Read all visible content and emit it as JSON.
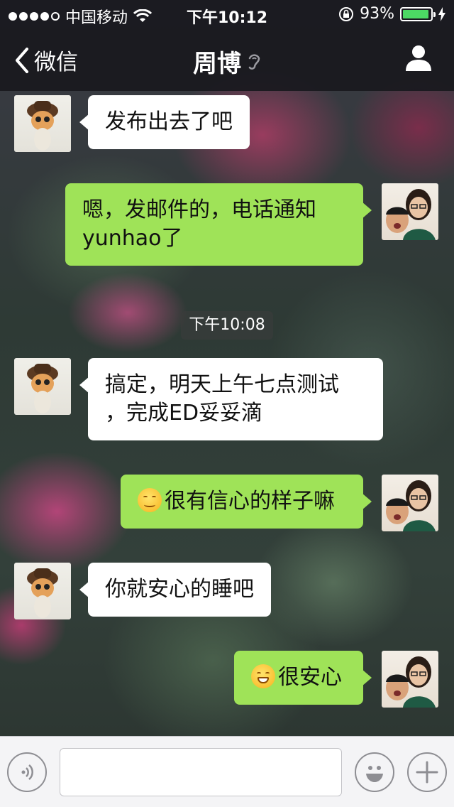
{
  "status_bar": {
    "carrier": "中国移动",
    "time": "下午10:12",
    "battery_percent": "93%",
    "battery_level": 0.93
  },
  "nav": {
    "back_label": "微信",
    "title": "周博",
    "icons": {
      "back": "chevron-left-icon",
      "ear": "earpiece-icon",
      "profile": "person-icon"
    }
  },
  "messages": [
    {
      "side": "in",
      "text": "发布出去了吧"
    },
    {
      "side": "out",
      "lines": [
        "嗯，发邮件的，电话通知",
        "yunhao了"
      ]
    },
    {
      "side": "in",
      "lines": [
        "搞定，明天上午七点测试",
        "，完成ED妥妥滴"
      ]
    },
    {
      "side": "out",
      "text": "很有信心的样子嘛",
      "emoji": "smile-emoji"
    },
    {
      "side": "in",
      "text": "你就安心的睡吧"
    },
    {
      "side": "out",
      "text": "很安心",
      "emoji": "grin-emoji"
    }
  ],
  "timestamp": "下午10:08",
  "input_bar": {
    "placeholder": "",
    "icons": {
      "voice": "voice-icon",
      "emoji": "emoji-icon",
      "add": "plus-icon"
    }
  },
  "colors": {
    "bubble_out": "#9fe358",
    "bubble_in": "#ffffff",
    "battery": "#4cd964",
    "header": "#19191e"
  }
}
